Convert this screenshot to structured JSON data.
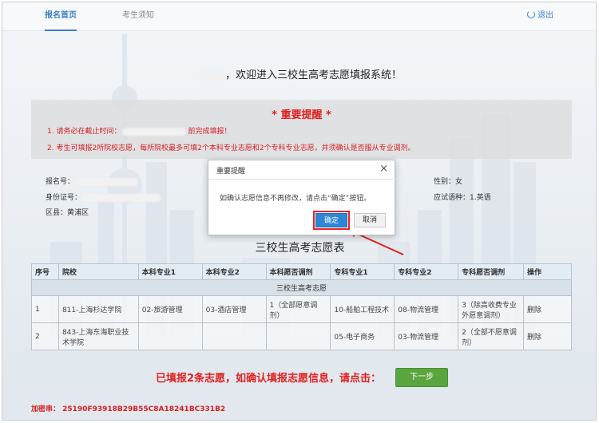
{
  "nav": {
    "tab_home": "报名首页",
    "tab_notice": "考生须知",
    "logout": "退出"
  },
  "welcome": "，欢迎进入三校生高考志愿填报系统！",
  "reminder": {
    "title": "* 重要提醒 *",
    "line1_a": "1. 请务必在截止时间：",
    "line1_b": "前完成填报！",
    "line2": "2. 考生可填报2所院校志愿，每所院校最多可填2个本科专业志愿和2个专科专业志愿，并须确认是否服从专业调剂。"
  },
  "info": {
    "reg_no_label": "报名号：",
    "id_label": "身份证号：",
    "district_label": "区县：",
    "district_value": "黄浦区",
    "gender": "性别：女",
    "language": "应试语种：1.英语"
  },
  "table": {
    "title": "三校生高考志愿表",
    "headers": [
      "序号",
      "院校",
      "本科专业1",
      "本科专业2",
      "本科愿否调剂",
      "专科专业1",
      "专科专业2",
      "专科愿否调剂",
      "操作"
    ],
    "section": "三校生高考志愿",
    "rows": [
      [
        "1",
        "811-上海杉达学院",
        "02-旅游管理",
        "03-酒店管理",
        "1（全部愿意调剂）",
        "10-船舶工程技术",
        "08-物流管理",
        "3（除高收费专业外愿意调剂）",
        "删除"
      ],
      [
        "2",
        "843-上海东海职业技术学院",
        "",
        "",
        "",
        "05-电子商务",
        "03-物流管理",
        "2（全部不愿意调剂）",
        "删除"
      ]
    ]
  },
  "bottom": {
    "text": "已填报2条志愿，如确认填报志愿信息，请点击：",
    "next": "下一步"
  },
  "encryption": "加密串：  25190F93918B29B55C8A18241BC331B2",
  "modal": {
    "title": "重要提醒",
    "close": "×",
    "body": "如确认志愿信息不再修改，请点击“确定”按钮。",
    "ok": "确定",
    "cancel": "取消"
  },
  "colors": {
    "accent": "#3a7fc4",
    "warning_red": "#e02020",
    "primary_button": "#2d86d6",
    "next_button": "#5aa53e"
  }
}
